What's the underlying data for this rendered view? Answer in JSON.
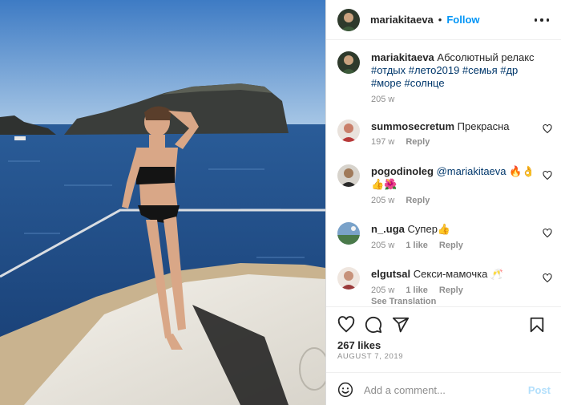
{
  "post": {
    "username": "mariakitaeva",
    "dot": "•",
    "follow_label": "Follow",
    "caption": {
      "username": "mariakitaeva",
      "text": "Абсолютный релакс",
      "hashtags_line1": "#отдых #лето2019 #семья #др",
      "hashtags_line2": "#море #солнце",
      "age": "205 w"
    },
    "comments": [
      {
        "username": "summosecretum",
        "text": "Прекрасна",
        "age": "197 w",
        "reply": "Reply"
      },
      {
        "username": "pogodinoleg",
        "mention": "@mariakitaeva",
        "text": "🔥👌",
        "text2": "👍🌺",
        "age": "205 w",
        "reply": "Reply"
      },
      {
        "username": "n_.uga",
        "text": "Супер👍",
        "age": "205 w",
        "likes": "1 like",
        "reply": "Reply"
      },
      {
        "username": "elgutsal",
        "text": "Секси-мамочка 🥂",
        "age": "205 w",
        "likes": "1 like",
        "reply": "Reply",
        "see_translation": "See Translation"
      }
    ],
    "likes": "267 likes",
    "date": "AUGUST 7, 2019",
    "add_comment_placeholder": "Add a comment...",
    "post_label": "Post"
  },
  "icons": [
    "more-icon",
    "heart-icon",
    "comment-icon",
    "share-icon",
    "bookmark-icon",
    "emoji-icon"
  ],
  "colors": {
    "accent": "#0095f6",
    "text": "#262626",
    "muted": "#8e8e8e",
    "post_disabled": "#b2dffc",
    "sea": "#1f4d8a"
  }
}
